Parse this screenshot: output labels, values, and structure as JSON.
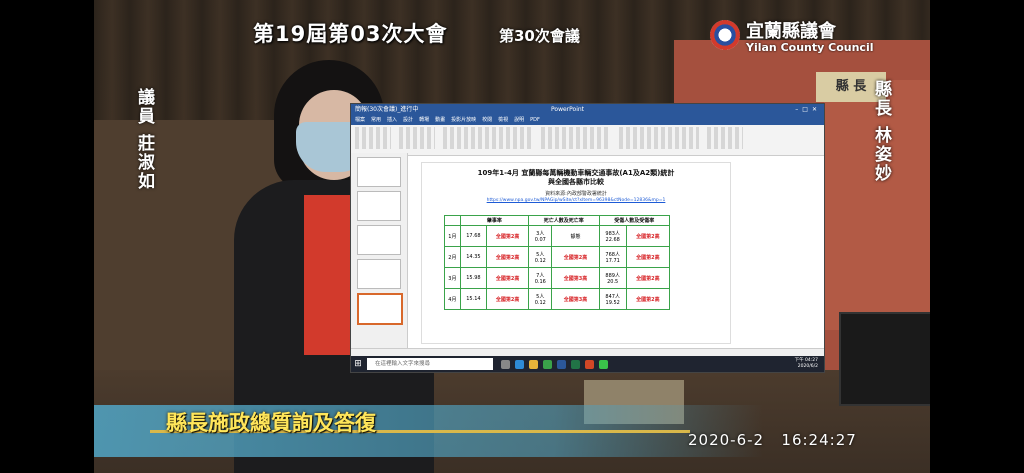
{
  "broadcast": {
    "session_title": "第19屆第03次大會",
    "meeting_number": "第30次會議",
    "council_name": "宜蘭縣議會",
    "council_name_en": "Yilan County Council",
    "left_speaker": "議員 莊淑如",
    "right_speaker": "縣長 林姿妙",
    "desk_plaque": "縣 長",
    "caption": "縣長施政總質詢及答復",
    "date": "2020-6-2",
    "time": "16:24:27"
  },
  "app": {
    "window_title": "簡報(30次會議)_進行中",
    "doc_title": "PowerPoint",
    "ribbon_tabs": [
      "檔案",
      "常用",
      "插入",
      "設計",
      "轉場",
      "動畫",
      "投影片放映",
      "校閱",
      "檢視",
      "說明",
      "PDF"
    ]
  },
  "slide": {
    "title_line1": "109年1-4月 宜蘭縣每萬輛機動車輛交通事故(A1及A2類)統計",
    "title_line2": "與全國各縣市比較",
    "source": "資料來源:內政部警政署統計",
    "link": "https://www.npa.gov.tw/NPAGip/wSite/ct?xItem=96398&ctNode=12836&mp=1",
    "table": {
      "headers": [
        "",
        "肇事率",
        "",
        "死亡人數及死亡率",
        "",
        "受傷人數及受傷率",
        ""
      ],
      "rows": [
        {
          "month": "1月",
          "rate": "17.68",
          "rate_rank": "全國第2高",
          "death": "3人\n0.07",
          "death_rank": "靜態",
          "injury": "983人\n22.68",
          "injury_rank": "全國第2高"
        },
        {
          "month": "2月",
          "rate": "14.35",
          "rate_rank": "全國第2高",
          "death": "5人\n0.12",
          "death_rank": "全國第2高",
          "injury": "768人\n17.71",
          "injury_rank": "全國第2高"
        },
        {
          "month": "3月",
          "rate": "15.98",
          "rate_rank": "全國第2高",
          "death": "7人\n0.16",
          "death_rank": "全國第3高",
          "injury": "889人\n20.5",
          "injury_rank": "全國第2高"
        },
        {
          "month": "4月",
          "rate": "15.14",
          "rate_rank": "全國第2高",
          "death": "5人\n0.12",
          "death_rank": "全國第3高",
          "injury": "847人\n19.52",
          "injury_rank": "全國第2高"
        }
      ]
    }
  },
  "taskbar": {
    "search_placeholder": "在這裡輸入文字來搜尋",
    "clock": "下午 04:27\n2020/6/2"
  },
  "colors": {
    "caption_text": "#ffe65a",
    "table_border": "#3aa34a",
    "rank_red": "#d8262a",
    "office_blue": "#2b579a"
  }
}
